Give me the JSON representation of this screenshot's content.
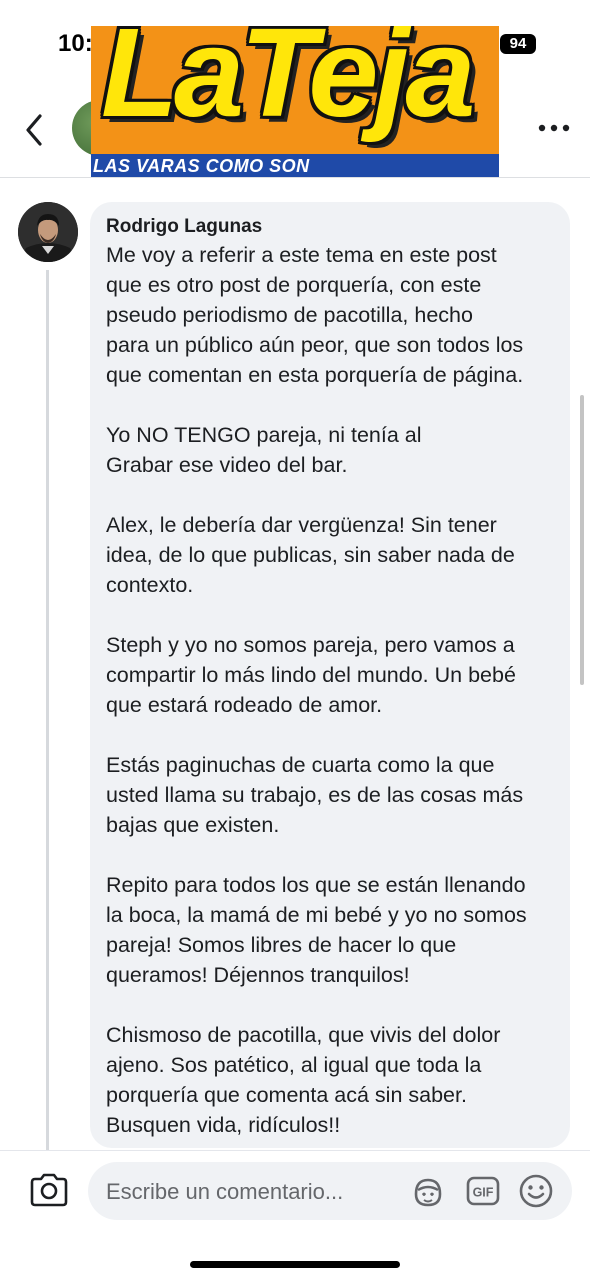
{
  "status_bar": {
    "time": "10:",
    "battery": "94"
  },
  "overlay_logo": {
    "title": "LaTeja",
    "tagline": "LAS VARAS COMO SON"
  },
  "comment": {
    "author": "Rodrigo Lagunas",
    "paragraphs": [
      "Me voy a referir a este tema en este post\nque es otro post de porquería, con este\npseudo periodismo de pacotilla, hecho\npara un público aún peor, que son todos los\nque comentan en esta porquería de página.",
      "Yo NO TENGO pareja, ni tenía al\nGrabar ese video del bar.",
      "Alex, le debería dar vergüenza! Sin tener\nidea, de lo que publicas, sin saber nada de\ncontexto.",
      "Steph y yo no somos pareja, pero vamos a\ncompartir lo más lindo del mundo. Un bebé\nque estará rodeado de amor.",
      "Estás paginuchas de cuarta como la que\nusted llama su trabajo, es de las cosas más\nbajas que existen.",
      "Repito para todos los que se están llenando\nla boca, la mamá de mi bebé y yo no somos\npareja! Somos libres de hacer lo que\nqueramos! Déjennos tranquilos!",
      "Chismoso de pacotilla, que vivis del dolor\najeno. Sos patético, al igual que toda la\nporquería que comenta acá sin saber.\nBusquen vida, ridículos!!"
    ]
  },
  "composer": {
    "placeholder": "Escribe un comentario...",
    "gif_label": "GIF"
  },
  "icons": {
    "back": "chevron-left-icon",
    "more": "more-horizontal-icon",
    "camera": "camera-icon",
    "avatar_sticker": "avatar-sticker-icon",
    "gif": "gif-icon",
    "emoji": "smiley-icon"
  },
  "colors": {
    "bubble": "#f0f2f5",
    "logo_orange": "#f39217",
    "logo_yellow": "#ffe60a",
    "logo_blue": "#1f4aa8"
  }
}
